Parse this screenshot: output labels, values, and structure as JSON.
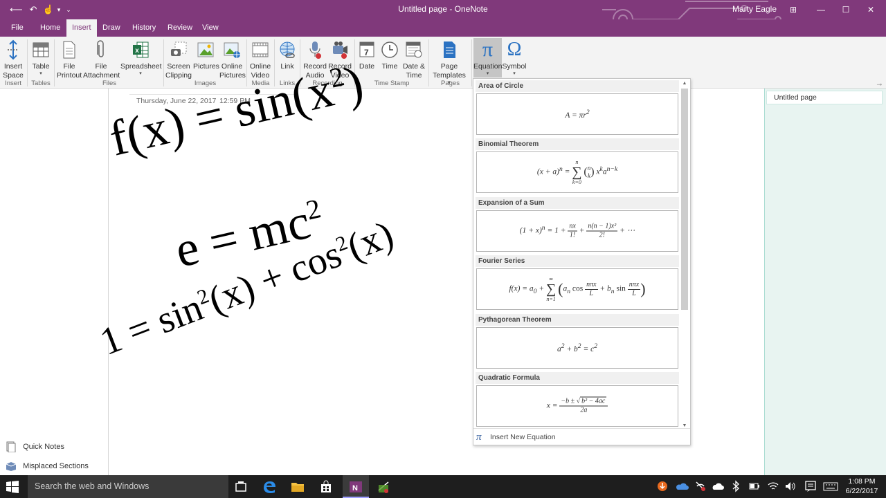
{
  "window": {
    "title": "Untitled page - OneNote",
    "user": "Marty Eagle",
    "controls": {
      "help": "⊞",
      "minimize": "—",
      "maximize": "☐",
      "close": "✕"
    }
  },
  "quick_access": {
    "back": "⟵",
    "undo": "↶",
    "touch": "☝",
    "dropdown": "▾",
    "more": "⌄"
  },
  "tabs": [
    "File",
    "Home",
    "Insert",
    "Draw",
    "History",
    "Review",
    "View"
  ],
  "active_tab": "Insert",
  "ribbon": {
    "insert_space": "Insert Space",
    "table": "Table",
    "file_printout": "File Printout",
    "file_attachment": "File Attachment",
    "spreadsheet": "Spreadsheet",
    "screen_clipping": "Screen Clipping",
    "pictures": "Pictures",
    "online_pictures": "Online Pictures",
    "online_video": "Online Video",
    "link": "Link",
    "record_audio": "Record Audio",
    "record_video": "Record Video",
    "date": "Date",
    "time": "Time",
    "date_time": "Date & Time",
    "page_templates": "Page Templates",
    "equation": "Equation",
    "symbol": "Symbol",
    "groups": {
      "insert": "Insert",
      "tables": "Tables",
      "files": "Files",
      "images": "Images",
      "media": "Media",
      "links": "Links",
      "recording": "Recording",
      "time_stamp": "Time Stamp",
      "pages": "Pages"
    },
    "icons": {
      "calendar_day": "7",
      "pi": "π",
      "omega": "Ω",
      "caret": "▾"
    }
  },
  "page": {
    "date": "Thursday, June 22, 2017",
    "time": "12:59 PM",
    "equations": {
      "eq1": {
        "base": "f(x) = sin(x",
        "sup": "2",
        "end": ")"
      },
      "eq2": {
        "base": "e = mc",
        "sup": "2"
      },
      "eq3": {
        "a": "1 = sin",
        "sup1": "2",
        "b": "(x) + cos",
        "sup2": "2",
        "c": "(x)"
      }
    }
  },
  "left_pane": {
    "quick_notes": "Quick Notes",
    "misplaced_sections": "Misplaced Sections"
  },
  "right_pane": {
    "pages": [
      "Untitled page"
    ],
    "pin": "⊸"
  },
  "gallery": {
    "items": [
      {
        "title": "Area of Circle"
      },
      {
        "title": "Binomial Theorem"
      },
      {
        "title": "Expansion of a Sum"
      },
      {
        "title": "Fourier Series"
      },
      {
        "title": "Pythagorean Theorem"
      },
      {
        "title": "Quadratic Formula"
      }
    ],
    "formulas": {
      "area": {
        "lhs": "A = πr",
        "sup": "2"
      },
      "binomial": {
        "lhs": "(x + a)",
        "lhs_sup": "n",
        "eq": " = ",
        "sum_top": "n",
        "sum_bot": "k=0",
        "sigma": "∑",
        "bn": "n",
        "bk": "k",
        "lp": "(",
        "rp": ")",
        "x": "x",
        "x_sup": "k",
        "a": "a",
        "a_sup": "n−k"
      },
      "expansion": {
        "lhs": "(1 + x)",
        "lhs_sup": "n",
        "mid": " = 1 + ",
        "f1n": "nx",
        "f1d": "1!",
        "plus": " + ",
        "f2n": "n(n − 1)x²",
        "f2d": "2!",
        "tail": " + ⋯"
      },
      "fourier": {
        "lhs": "f(x) = a",
        "sub0": "0",
        "plus": " + ",
        "sigma": "∑",
        "sum_top": "∞",
        "sum_bot": "n=1",
        "lp": "(",
        "an": "a",
        "subn": "n",
        "cos": " cos ",
        "fn": "nπx",
        "fd": "L",
        "plus2": " + b",
        "sin": " sin ",
        "rp": ")"
      },
      "pythagorean": {
        "a": "a",
        "a_sup": "2",
        "plus": " + b",
        "b_sup": "2",
        "eq": " = c",
        "c_sup": "2"
      },
      "quadratic": {
        "lhs": "x = ",
        "num_a": "−b ± ",
        "num_rad": "b² − 4ac",
        "den": "2a",
        "radical": "√"
      }
    },
    "scroll_up": "▲",
    "scroll_down": "▼",
    "insert_new": "Insert New Equation",
    "insert_new_icon": "π"
  },
  "taskbar": {
    "search_placeholder": "Search the web and Windows",
    "time": "1:08 PM",
    "date": "6/22/2017",
    "tray_up": "^"
  }
}
